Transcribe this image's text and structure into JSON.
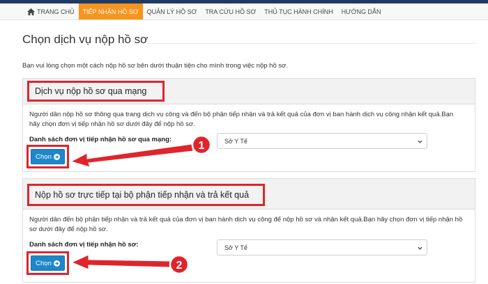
{
  "nav": {
    "items": [
      "TRANG CHỦ",
      "TIẾP NHẬN HỒ SƠ",
      "QUẢN LÝ HỒ SƠ",
      "TRA CỨU HỒ SƠ",
      "THỦ TỤC HÀNH CHÍNH",
      "HƯỚNG DẪN"
    ],
    "active_index": 1
  },
  "page": {
    "title": "Chọn dịch vụ nộp hồ sơ",
    "intro": "Bạn vui lòng chọn một cách nộp hồ sơ bên dưới thuận tiện cho mình trong việc nộp hồ sơ."
  },
  "online": {
    "title": "Dịch vụ nộp hồ sơ qua mạng",
    "description": "Người dân nộp hồ sơ thông qua trang dịch vụ công và đến bộ phận tiếp nhận và trả kết quả của đơn vị ban hành dịch vụ công nhận kết quả.Bạn hãy chọn đơn vị tiếp nhận hồ sơ dưới đây để nộp hồ sơ.",
    "field_label": "Danh sách đơn vị tiếp nhận hồ sơ qua mạng:",
    "selected": "Sở Y Tế",
    "button": "Chọn",
    "callout": "1"
  },
  "direct": {
    "title": "Nộp hồ sơ trực tiếp tại bộ phận tiếp nhận và trả kết quả",
    "description": "Người dân đến bộ phận tiếp nhận và trả kết quả của đơn vị ban hành dịch vụ công để nộp hồ sơ và nhận kết quả.Bạn hãy chọn đơn vị tiếp nhận hồ sơ dưới đây để nộp hồ sơ.",
    "field_label": "Danh sách đơn vị tiếp nhận hồ sơ:",
    "selected": "Sở Y Tế",
    "button": "Chọn",
    "callout": "2"
  },
  "colors": {
    "nav_active": "#f7941d",
    "button": "#1e87c9",
    "annotation_red": "#e0242b"
  },
  "icons": [
    "home-icon",
    "chevron-down-icon",
    "circle-arrow-right-icon",
    "red-arrow-annotation"
  ]
}
